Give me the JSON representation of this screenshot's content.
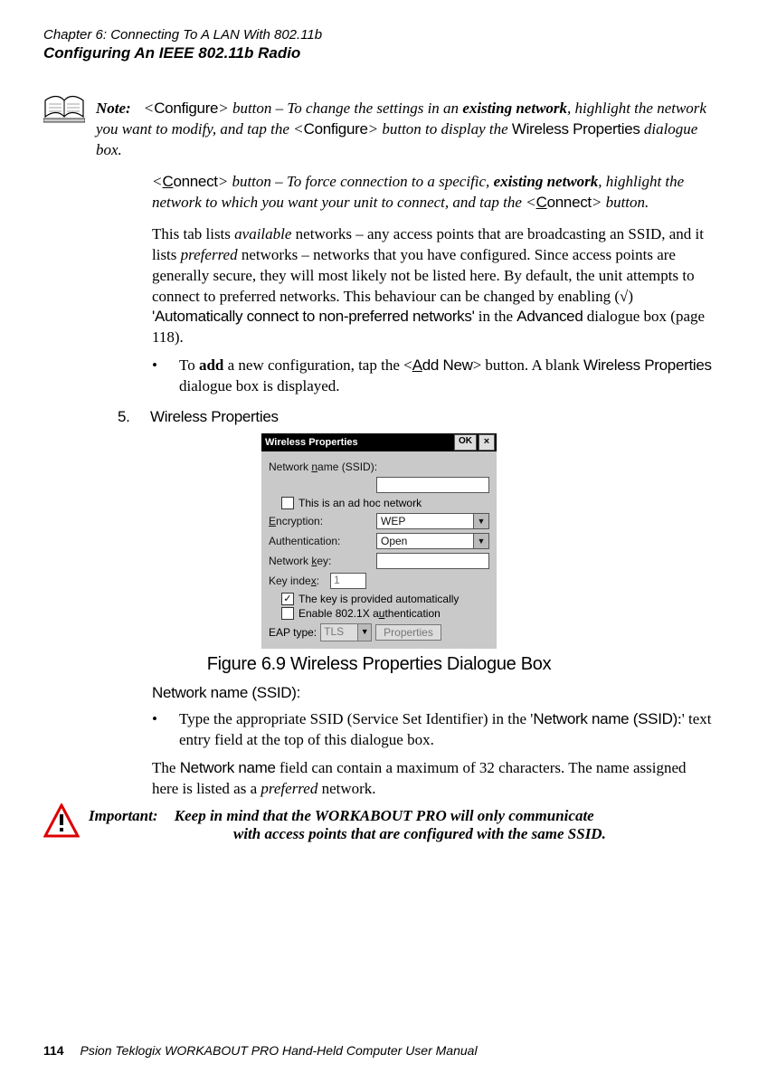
{
  "header": {
    "chapter": "Chapter 6:  Connecting To A LAN With 802.11b",
    "section": "Configuring An IEEE 802.11b Radio"
  },
  "note": {
    "label": "Note:",
    "p1_lead": "<",
    "p1_cfg": "Configure",
    "p1_tail_a": "> button – To change the settings in an ",
    "p1_exist": "existing network",
    "p1_b": ", highlight the network you want to modify, and tap the <",
    "p1_cfg2": "Configure",
    "p1_c": "> button to display the ",
    "p1_wp": "Wireless Properties",
    "p1_d": " dialogue box.",
    "p2_a": "<",
    "p2_conn_u": "C",
    "p2_conn_rest": "onnect",
    "p2_b": "> button – To force connection to a specific, ",
    "p2_exist": "existing network",
    "p2_c": ", highlight the network to which you want your unit to connect, and tap the <",
    "p2_conn2_u": "C",
    "p2_conn2_rest": "onnect",
    "p2_d": "> button."
  },
  "body": {
    "para": "This tab lists available networks – any access points that are broadcasting an SSID, and it lists preferred networks – networks that you have configured. Since access points are generally secure, they will most likely not be listed here. By default, the unit attempts to connect to preferred networks. This behaviour can be changed by enabling (√) 'Automatically connect to non-preferred networks' in the Advanced dialogue box (page 118).",
    "para_a": "This tab lists ",
    "para_avail": "available",
    "para_b": " networks – any access points that are broadcasting an SSID, and it lists ",
    "para_pref": "preferred",
    "para_c": " networks – networks that you have configured. Since access points are generally secure, they will most likely not be listed here. By default, the unit attempts to connect to preferred networks. This behaviour can be changed by enabling (√) ",
    "para_auto": "'Automatically connect to non-preferred networks'",
    "para_d": " in the ",
    "para_adv": "Advanced",
    "para_e": " dialogue box (page 118).",
    "bullet_a": "To ",
    "bullet_add": "add",
    "bullet_b": " a new configuration, tap the <",
    "bullet_add_u": "A",
    "bullet_add_rest": "dd New",
    "bullet_c": "> button. A blank ",
    "bullet_wp": "Wireless Properties",
    "bullet_d": " dialogue box is displayed."
  },
  "step": {
    "num": "5.",
    "label": "Wireless Properties"
  },
  "dialog": {
    "title": "Wireless Properties",
    "ok": "OK",
    "close": "×",
    "lbl_ssid_a": "Network ",
    "lbl_ssid_u": "n",
    "lbl_ssid_b": "ame (SSID):",
    "ssid_value": "",
    "chk_adhoc": "This is an ad hoc network",
    "lbl_enc_u": "E",
    "lbl_enc_rest": "ncryption:",
    "enc_value": "WEP",
    "lbl_auth": "Authentication:",
    "auth_value": "Open",
    "lbl_key_a": "Network ",
    "lbl_key_u": "k",
    "lbl_key_b": "ey:",
    "key_value": "",
    "lbl_idx": "Key index:",
    "lbl_idx_a": "Key inde",
    "lbl_idx_u": "x",
    "lbl_idx_b": ":",
    "idx_value": "1",
    "chk_auto": "The key is provided automatically",
    "chk_8021x_a": "Enable 802.1X a",
    "chk_8021x_u": "u",
    "chk_8021x_b": "thentication",
    "lbl_eap": "EAP type:",
    "eap_value": "TLS",
    "btn_props": "Properties"
  },
  "caption": "Figure 6.9 Wireless Properties Dialogue Box",
  "ssid": {
    "heading": "Network name (SSID):",
    "bullet_a": "Type the appropriate SSID (Service Set Identifier) in the '",
    "bullet_net": "Network name (SSID)",
    "bullet_b": ":' text entry field at the top of this dialogue box.",
    "para_a": "The ",
    "para_net": "Network name",
    "para_b": " field can contain a maximum of 32 characters. The name assigned here is listed as a ",
    "para_pref": "preferred",
    "para_c": " network."
  },
  "important": {
    "label": "Important:",
    "text_a": "Keep in mind that the WORKABOUT PRO will only communicate",
    "text_b": "with access points that are configured with the same SSID."
  },
  "footer": {
    "page": "114",
    "manual": "Psion Teklogix WORKABOUT PRO Hand-Held Computer User Manual"
  }
}
